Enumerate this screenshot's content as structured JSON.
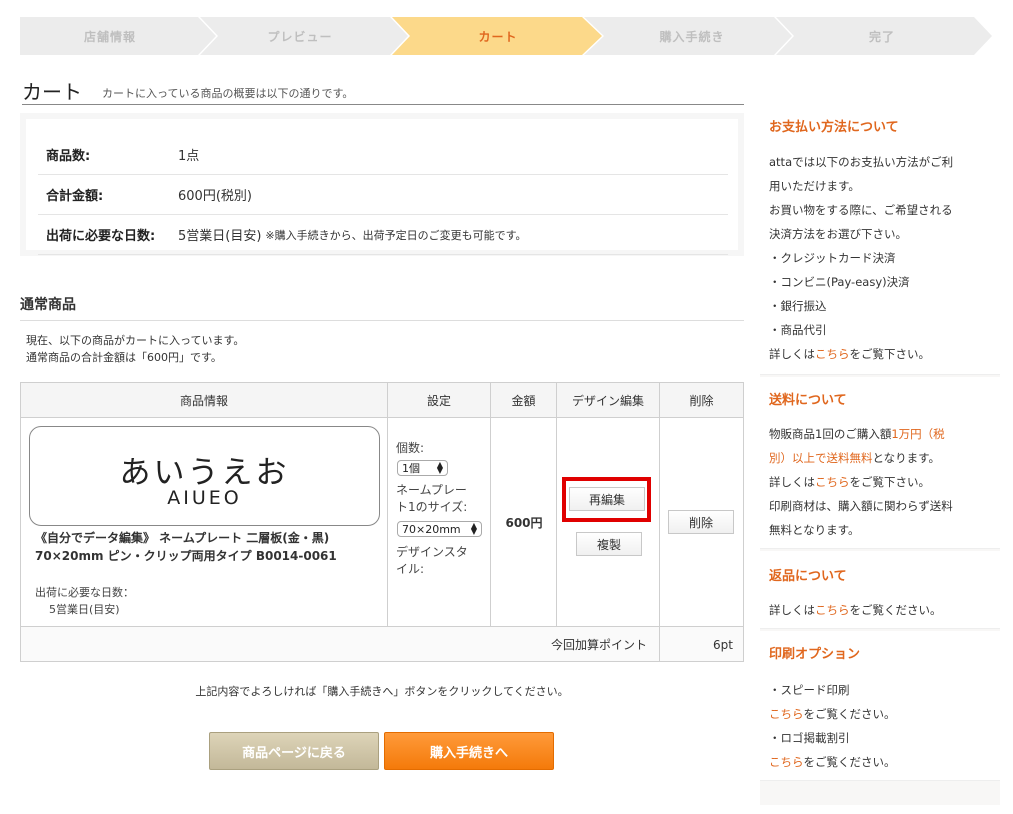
{
  "steps": [
    {
      "label": "店舗情報",
      "active": false
    },
    {
      "label": "プレビュー",
      "active": false
    },
    {
      "label": "カート",
      "active": true
    },
    {
      "label": "購入手続き",
      "active": false
    },
    {
      "label": "完了",
      "active": false
    }
  ],
  "page": {
    "title": "カート",
    "subtitle": "カートに入っている商品の概要は以下の通りです。"
  },
  "summary": {
    "count_label": "商品数:",
    "count_value": "1点",
    "total_label": "合計金額:",
    "total_value": "600円(税別)",
    "days_label": "出荷に必要な日数:",
    "days_value": "5営業日(目安)",
    "days_note": "※購入手続きから、出荷予定日のご変更も可能です。"
  },
  "section": {
    "title": "通常商品",
    "desc1": "現在、以下の商品がカートに入っています。",
    "desc2": "通常商品の合計金額は「600円」です。"
  },
  "table": {
    "headers": {
      "info": "商品情報",
      "settings": "設定",
      "price": "金額",
      "design": "デザイン編集",
      "delete": "削除"
    },
    "item": {
      "plate_text_jp": "あいうえお",
      "plate_text_en": "AIUEO",
      "name_line1": "《自分でデータ編集》 ネームプレート 二層板(金・黒)",
      "name_line2": "70×20mm ピン・クリップ両用タイプ B0014-0061",
      "ship_label": "出荷に必要な日数：",
      "ship_value": "5営業日(目安)",
      "qty_label": "個数:",
      "qty_value": "1個",
      "size_label_1": "ネームプレー",
      "size_label_2": "ト1のサイズ:",
      "size_value": "70×20mm",
      "style_label_1": "デザインスタ",
      "style_label_2": "イル:",
      "price": "600円",
      "reedit_label": "再編集",
      "copy_label": "複製",
      "delete_label": "削除"
    },
    "points_label": "今回加算ポイント",
    "points_value": "6pt"
  },
  "confirm_text": "上記内容でよろしければ「購入手続きへ」ボタンをクリックしてください。",
  "buttons": {
    "back": "商品ページに戻る",
    "next": "購入手続きへ"
  },
  "sidebar": {
    "payment": {
      "title": "お支払い方法について",
      "lines": [
        "attaでは以下のお支払い方法がご利",
        "用いただけます。",
        "お買い物をする際に、ご希望される",
        "決済方法をお選び下さい。",
        "・クレジットカード決済",
        "・コンビニ(Pay-easy)決済",
        "・銀行振込",
        "・商品代引"
      ],
      "more_pre": "詳しくは",
      "more_link": "こちら",
      "more_post": "をご覧下さい。"
    },
    "shipping": {
      "title": "送料について",
      "l1_pre": "物販商品1回のご購入額",
      "l1_hl": "1万円（税",
      "l2_hl": "別）以上で送料無料",
      "l2_post": "となります。",
      "more_pre": "詳しくは",
      "more_link": "こちら",
      "more_post": "をご覧下さい。",
      "l4": "印刷商材は、購入額に関わらず送料",
      "l5": "無料となります。"
    },
    "returns": {
      "title": "返品について",
      "more_pre": "詳しくは",
      "more_link": "こちら",
      "more_post": "をご覧ください。"
    },
    "print": {
      "title": "印刷オプション",
      "opt1": "・スピード印刷",
      "opt1_link": "こちら",
      "opt1_post": "をご覧ください。",
      "opt2": "・ロゴ掲載割引",
      "opt2_link": "こちら",
      "opt2_post": "をご覧ください。"
    }
  },
  "colors": {
    "accent": "#e0671e",
    "step_active": "#fcd98a",
    "highlight_box": "#e00000"
  }
}
